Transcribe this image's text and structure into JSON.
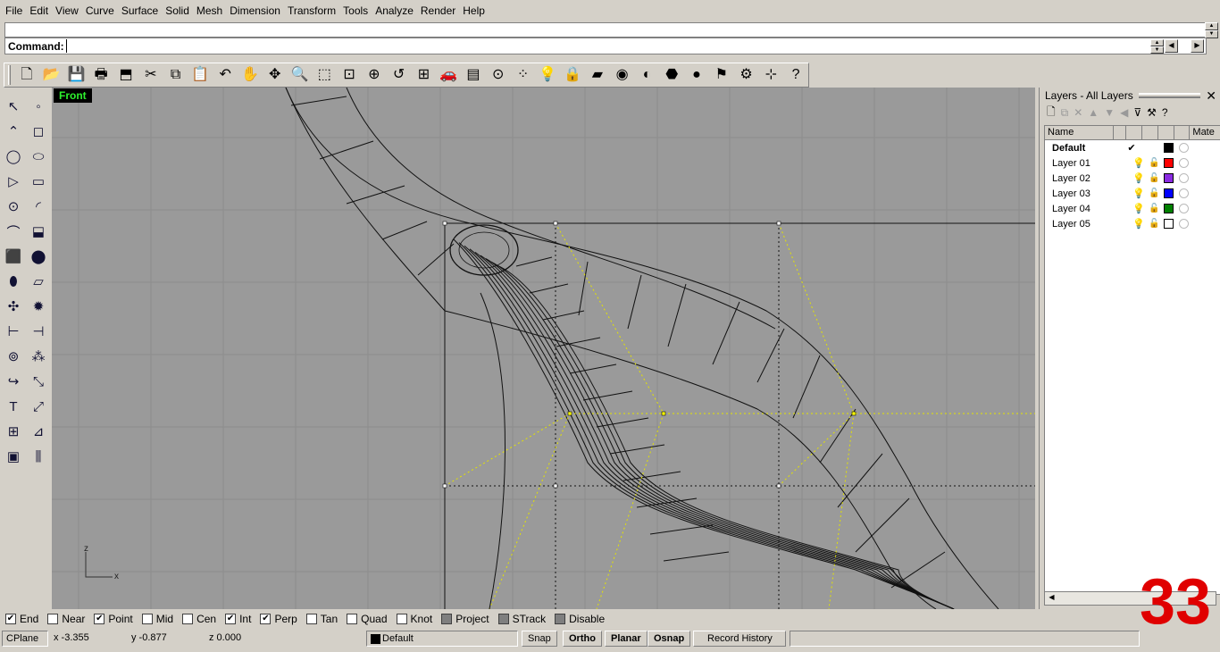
{
  "menu": [
    "File",
    "Edit",
    "View",
    "Curve",
    "Surface",
    "Solid",
    "Mesh",
    "Dimension",
    "Transform",
    "Tools",
    "Analyze",
    "Render",
    "Help"
  ],
  "command": {
    "label": "Command:",
    "value": ""
  },
  "toolbar": {
    "icons": [
      "new-file-icon",
      "open-folder-icon",
      "save-icon",
      "print-icon",
      "import-icon",
      "cut-icon",
      "copy-icon",
      "paste-icon",
      "undo-icon",
      "pan-hand-icon",
      "rotate-view-icon",
      "zoom-icon",
      "zoom-window-icon",
      "zoom-extents-icon",
      "zoom-selected-icon",
      "undo-view-icon",
      "four-viewports-icon",
      "car-icon",
      "tools-icon",
      "osnap-icon",
      "points-icon",
      "lightbulb-icon",
      "lock-icon",
      "layer-icon",
      "color-wheel-icon",
      "shade-icon",
      "rendered-sphere-icon",
      "render-icon",
      "flag-icon",
      "options-gear-icon",
      "grid-snap-icon",
      "help-icon"
    ],
    "glyphs": [
      "🗋",
      "📂",
      "💾",
      "🖶",
      "⬒",
      "✂",
      "⧉",
      "📋",
      "↶",
      "✋",
      "✥",
      "🔍",
      "⬚",
      "⊡",
      "⊕",
      "↺",
      "⊞",
      "🚗",
      "▤",
      "⊙",
      "⁘",
      "💡",
      "🔒",
      "▰",
      "◉",
      "◐",
      "⬣",
      "●",
      "⚑",
      "⚙",
      "⊹",
      "?"
    ]
  },
  "left_tools": {
    "icons": [
      "select-arrow-icon",
      "point-icon",
      "polyline-icon",
      "curve-cv-icon",
      "circle-icon",
      "ellipse-icon",
      "polygon-icon",
      "rectangle-icon",
      "arc-center-icon",
      "fillet-curve-icon",
      "surface-cv-icon",
      "extrude-icon",
      "box-icon",
      "sphere-icon",
      "cylinder-icon",
      "plane-surface-icon",
      "boolean-icon",
      "explode-icon",
      "trim-icon",
      "split-icon",
      "union-icon",
      "array-icon",
      "rotate-icon",
      "scale-icon",
      "text-icon",
      "dimension-icon",
      "group-icon",
      "analyze-icon",
      "block-icon",
      "hatch-icon"
    ],
    "glyphs": [
      "↖",
      "◦",
      "⌃",
      "◻",
      "◯",
      "⬭",
      "▷",
      "▭",
      "⊙",
      "◜",
      "⌒",
      "⬓",
      "⬛",
      "⬤",
      "⬮",
      "▱",
      "✣",
      "✹",
      "⊢",
      "⊣",
      "⊚",
      "⁂",
      "↪",
      "⤡",
      "T",
      "⤢",
      "⊞",
      "⊿",
      "▣",
      "⫼"
    ]
  },
  "viewport": {
    "title": "Front",
    "axis_z": "z",
    "axis_x": "x"
  },
  "layers": {
    "title": "Layers - All Layers",
    "columns": [
      "Name",
      "Mate"
    ],
    "rows": [
      {
        "name": "Default",
        "current": true,
        "color": "#000000"
      },
      {
        "name": "Layer 01",
        "current": false,
        "color": "#ff0000"
      },
      {
        "name": "Layer 02",
        "current": false,
        "color": "#8b2be2"
      },
      {
        "name": "Layer 03",
        "current": false,
        "color": "#0000ff"
      },
      {
        "name": "Layer 04",
        "current": false,
        "color": "#008000"
      },
      {
        "name": "Layer 05",
        "current": false,
        "color": "#ffffff"
      }
    ],
    "check": "✔"
  },
  "osnap": [
    {
      "label": "End",
      "checked": true
    },
    {
      "label": "Near",
      "checked": false
    },
    {
      "label": "Point",
      "checked": true
    },
    {
      "label": "Mid",
      "checked": false
    },
    {
      "label": "Cen",
      "checked": false
    },
    {
      "label": "Int",
      "checked": true
    },
    {
      "label": "Perp",
      "checked": true
    },
    {
      "label": "Tan",
      "checked": false
    },
    {
      "label": "Quad",
      "checked": false
    },
    {
      "label": "Knot",
      "checked": false
    },
    {
      "label": "Project",
      "checked": false,
      "grey": true
    },
    {
      "label": "STrack",
      "checked": false,
      "grey": true
    },
    {
      "label": "Disable",
      "checked": false,
      "grey": true
    }
  ],
  "status": {
    "cplane": "CPlane",
    "x": "x -3.355",
    "y": "y -0.877",
    "z": "z 0.000",
    "layer": "Default",
    "snap": "Snap",
    "ortho": "Ortho",
    "planar": "Planar",
    "osnap": "Osnap",
    "record": "Record History"
  },
  "overlay_number": "33"
}
